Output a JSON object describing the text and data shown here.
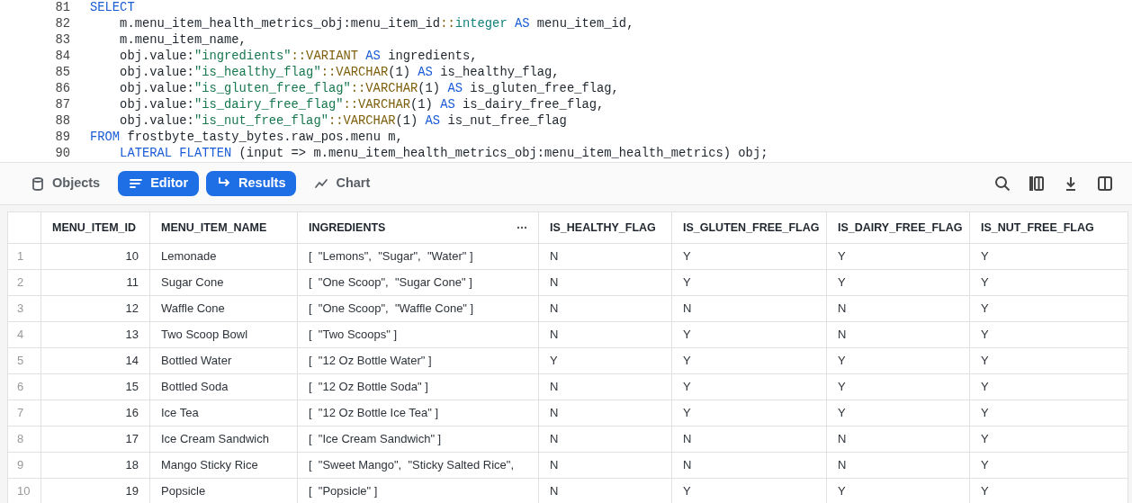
{
  "editor": {
    "lines": [
      {
        "number": "81",
        "indented": false,
        "tokens": [
          {
            "text": "SELECT",
            "kind": "keyword"
          }
        ]
      },
      {
        "number": "82",
        "indented": true,
        "tokens": [
          {
            "text": "m.menu_item_health_metrics_obj:menu_item_id",
            "kind": "plain"
          },
          {
            "text": "::",
            "kind": "cast"
          },
          {
            "text": "integer",
            "kind": "type"
          },
          {
            "text": " AS",
            "kind": "keyword"
          },
          {
            "text": " menu_item_id,",
            "kind": "plain"
          }
        ]
      },
      {
        "number": "83",
        "indented": true,
        "tokens": [
          {
            "text": "m.menu_item_name,",
            "kind": "plain"
          }
        ]
      },
      {
        "number": "84",
        "indented": true,
        "tokens": [
          {
            "text": "obj.value:",
            "kind": "plain"
          },
          {
            "text": "\"ingredients\"",
            "kind": "string"
          },
          {
            "text": "::VARIANT",
            "kind": "cast"
          },
          {
            "text": " AS",
            "kind": "keyword"
          },
          {
            "text": " ingredients,",
            "kind": "plain"
          }
        ]
      },
      {
        "number": "85",
        "indented": true,
        "tokens": [
          {
            "text": "obj.value:",
            "kind": "plain"
          },
          {
            "text": "\"is_healthy_flag\"",
            "kind": "string"
          },
          {
            "text": "::VARCHAR",
            "kind": "cast"
          },
          {
            "text": "(1) ",
            "kind": "plain"
          },
          {
            "text": "AS",
            "kind": "keyword"
          },
          {
            "text": " is_healthy_flag,",
            "kind": "plain"
          }
        ]
      },
      {
        "number": "86",
        "indented": true,
        "tokens": [
          {
            "text": "obj.value:",
            "kind": "plain"
          },
          {
            "text": "\"is_gluten_free_flag\"",
            "kind": "string"
          },
          {
            "text": "::VARCHAR",
            "kind": "cast"
          },
          {
            "text": "(1) ",
            "kind": "plain"
          },
          {
            "text": "AS",
            "kind": "keyword"
          },
          {
            "text": " is_gluten_free_flag,",
            "kind": "plain"
          }
        ]
      },
      {
        "number": "87",
        "indented": true,
        "tokens": [
          {
            "text": "obj.value:",
            "kind": "plain"
          },
          {
            "text": "\"is_dairy_free_flag\"",
            "kind": "string"
          },
          {
            "text": "::VARCHAR",
            "kind": "cast"
          },
          {
            "text": "(1) ",
            "kind": "plain"
          },
          {
            "text": "AS",
            "kind": "keyword"
          },
          {
            "text": " is_dairy_free_flag,",
            "kind": "plain"
          }
        ]
      },
      {
        "number": "88",
        "indented": true,
        "tokens": [
          {
            "text": "obj.value:",
            "kind": "plain"
          },
          {
            "text": "\"is_nut_free_flag\"",
            "kind": "string"
          },
          {
            "text": "::VARCHAR",
            "kind": "cast"
          },
          {
            "text": "(1) ",
            "kind": "plain"
          },
          {
            "text": "AS",
            "kind": "keyword"
          },
          {
            "text": " is_nut_free_flag",
            "kind": "plain"
          }
        ]
      },
      {
        "number": "89",
        "indented": false,
        "tokens": [
          {
            "text": "FROM",
            "kind": "keyword"
          },
          {
            "text": " frostbyte_tasty_bytes.raw_pos.menu m,",
            "kind": "plain"
          }
        ]
      },
      {
        "number": "90",
        "indented": true,
        "tokens": [
          {
            "text": "LATERAL FLATTEN",
            "kind": "keyword"
          },
          {
            "text": " (input => m.menu_item_health_metrics_obj:menu_item_health_metrics) obj;",
            "kind": "plain"
          }
        ]
      }
    ]
  },
  "toolbar": {
    "tabs": [
      {
        "label": "Objects",
        "selected": false
      },
      {
        "label": "Editor",
        "selected": true
      },
      {
        "label": "Results",
        "selected": true
      },
      {
        "label": "Chart",
        "selected": false
      }
    ]
  },
  "table": {
    "columns": [
      "MENU_ITEM_ID",
      "MENU_ITEM_NAME",
      "INGREDIENTS",
      "IS_HEALTHY_FLAG",
      "IS_GLUTEN_FREE_FLAG",
      "IS_DAIRY_FREE_FLAG",
      "IS_NUT_FREE_FLAG"
    ],
    "rows": [
      {
        "index": "1",
        "cells": [
          "10",
          "Lemonade",
          "[  \"Lemons\",  \"Sugar\",  \"Water\" ]",
          "N",
          "Y",
          "Y",
          "Y"
        ]
      },
      {
        "index": "2",
        "cells": [
          "11",
          "Sugar Cone",
          "[  \"One Scoop\",  \"Sugar Cone\" ]",
          "N",
          "Y",
          "Y",
          "Y"
        ]
      },
      {
        "index": "3",
        "cells": [
          "12",
          "Waffle Cone",
          "[  \"One Scoop\",  \"Waffle Cone\" ]",
          "N",
          "N",
          "N",
          "Y"
        ]
      },
      {
        "index": "4",
        "cells": [
          "13",
          "Two Scoop Bowl",
          "[  \"Two Scoops\" ]",
          "N",
          "Y",
          "N",
          "Y"
        ]
      },
      {
        "index": "5",
        "cells": [
          "14",
          "Bottled Water",
          "[  \"12 Oz Bottle Water\" ]",
          "Y",
          "Y",
          "Y",
          "Y"
        ]
      },
      {
        "index": "6",
        "cells": [
          "15",
          "Bottled Soda",
          "[  \"12 Oz Bottle Soda\" ]",
          "N",
          "Y",
          "Y",
          "Y"
        ]
      },
      {
        "index": "7",
        "cells": [
          "16",
          "Ice Tea",
          "[  \"12 Oz Bottle Ice Tea\" ]",
          "N",
          "Y",
          "Y",
          "Y"
        ]
      },
      {
        "index": "8",
        "cells": [
          "17",
          "Ice Cream Sandwich",
          "[  \"Ice Cream Sandwich\" ]",
          "N",
          "N",
          "N",
          "Y"
        ]
      },
      {
        "index": "9",
        "cells": [
          "18",
          "Mango Sticky Rice",
          "[  \"Sweet Mango\",  \"Sticky Salted Rice\",",
          "N",
          "N",
          "N",
          "Y"
        ]
      },
      {
        "index": "10",
        "cells": [
          "19",
          "Popsicle",
          "[  \"Popsicle\" ]",
          "N",
          "Y",
          "Y",
          "Y"
        ]
      }
    ]
  }
}
